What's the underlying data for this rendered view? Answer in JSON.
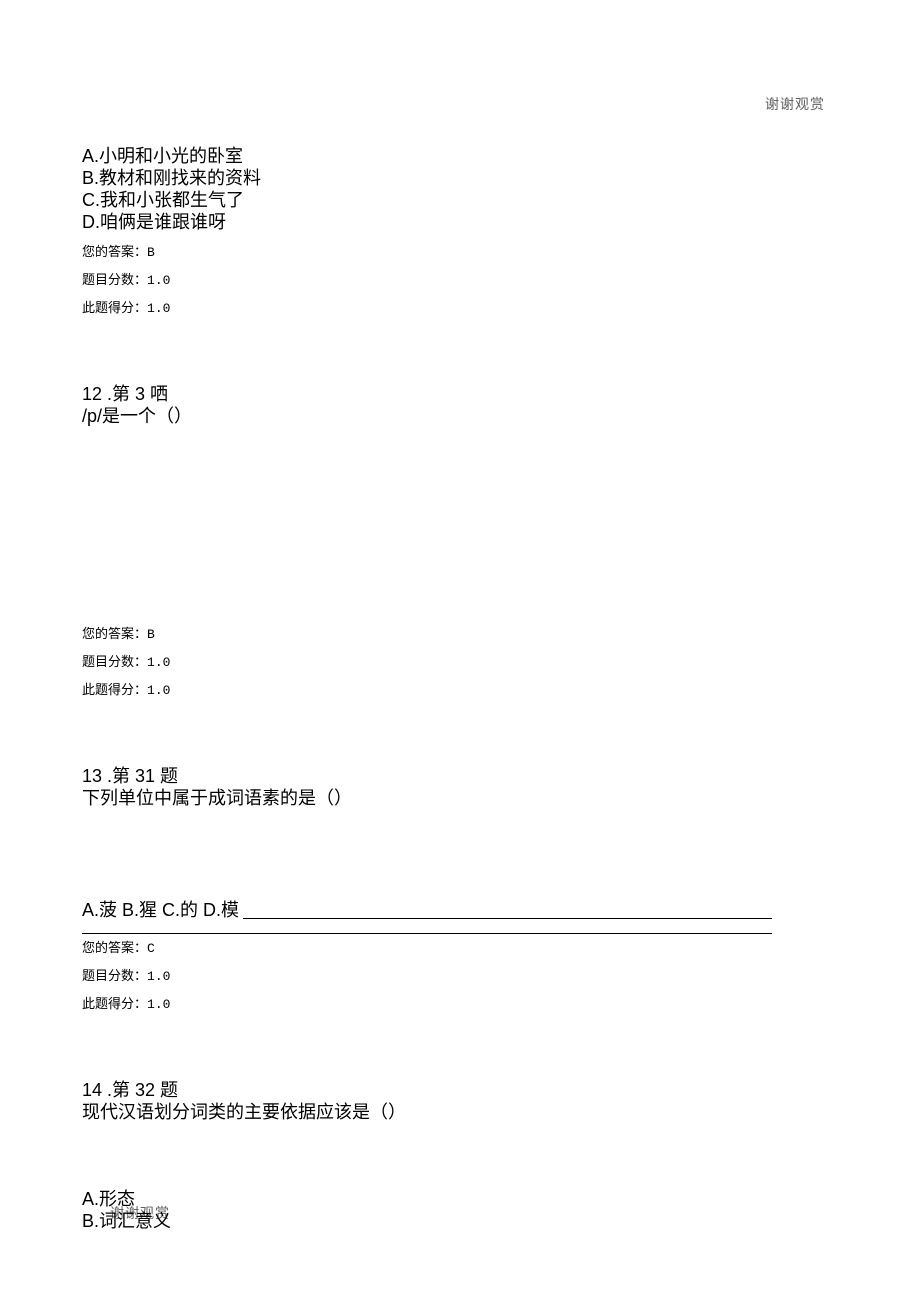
{
  "watermark": {
    "top": "谢谢观赏",
    "bottom": "谢谢观赏"
  },
  "q11_continued": {
    "options": {
      "A": "A.小明和小光的卧室",
      "B": "B.教材和刚找来的资料",
      "C": "C.我和小张都生气了",
      "D": "D.咱俩是谁跟谁呀"
    },
    "meta": {
      "answer_label": "您的答案：",
      "answer_value": "B",
      "score_label": "题目分数：",
      "score_value": "1.0",
      "got_label": "此题得分：",
      "got_value": "1.0"
    }
  },
  "q12": {
    "header": "12 .第 3 哂",
    "text": "/p/是一个（）",
    "meta": {
      "answer_label": "您的答案：",
      "answer_value": "B",
      "score_label": "题目分数：",
      "score_value": "1.0",
      "got_label": "此题得分：",
      "got_value": "1.0"
    }
  },
  "q13": {
    "header": "13 .第 31 题",
    "text": "下列单位中属于成词语素的是（）",
    "options_inline": "A.菠 B.猩 C.的 D.模",
    "meta": {
      "answer_label": "您的答案：",
      "answer_value": "C",
      "score_label": "题目分数：",
      "score_value": "1.0",
      "got_label": "此题得分：",
      "got_value": "1.0"
    }
  },
  "q14": {
    "header": "14 .第 32 题",
    "text": "现代汉语划分词类的主要依据应该是（）",
    "options": {
      "A": "A.形态",
      "B": "B.词汇意义"
    }
  }
}
